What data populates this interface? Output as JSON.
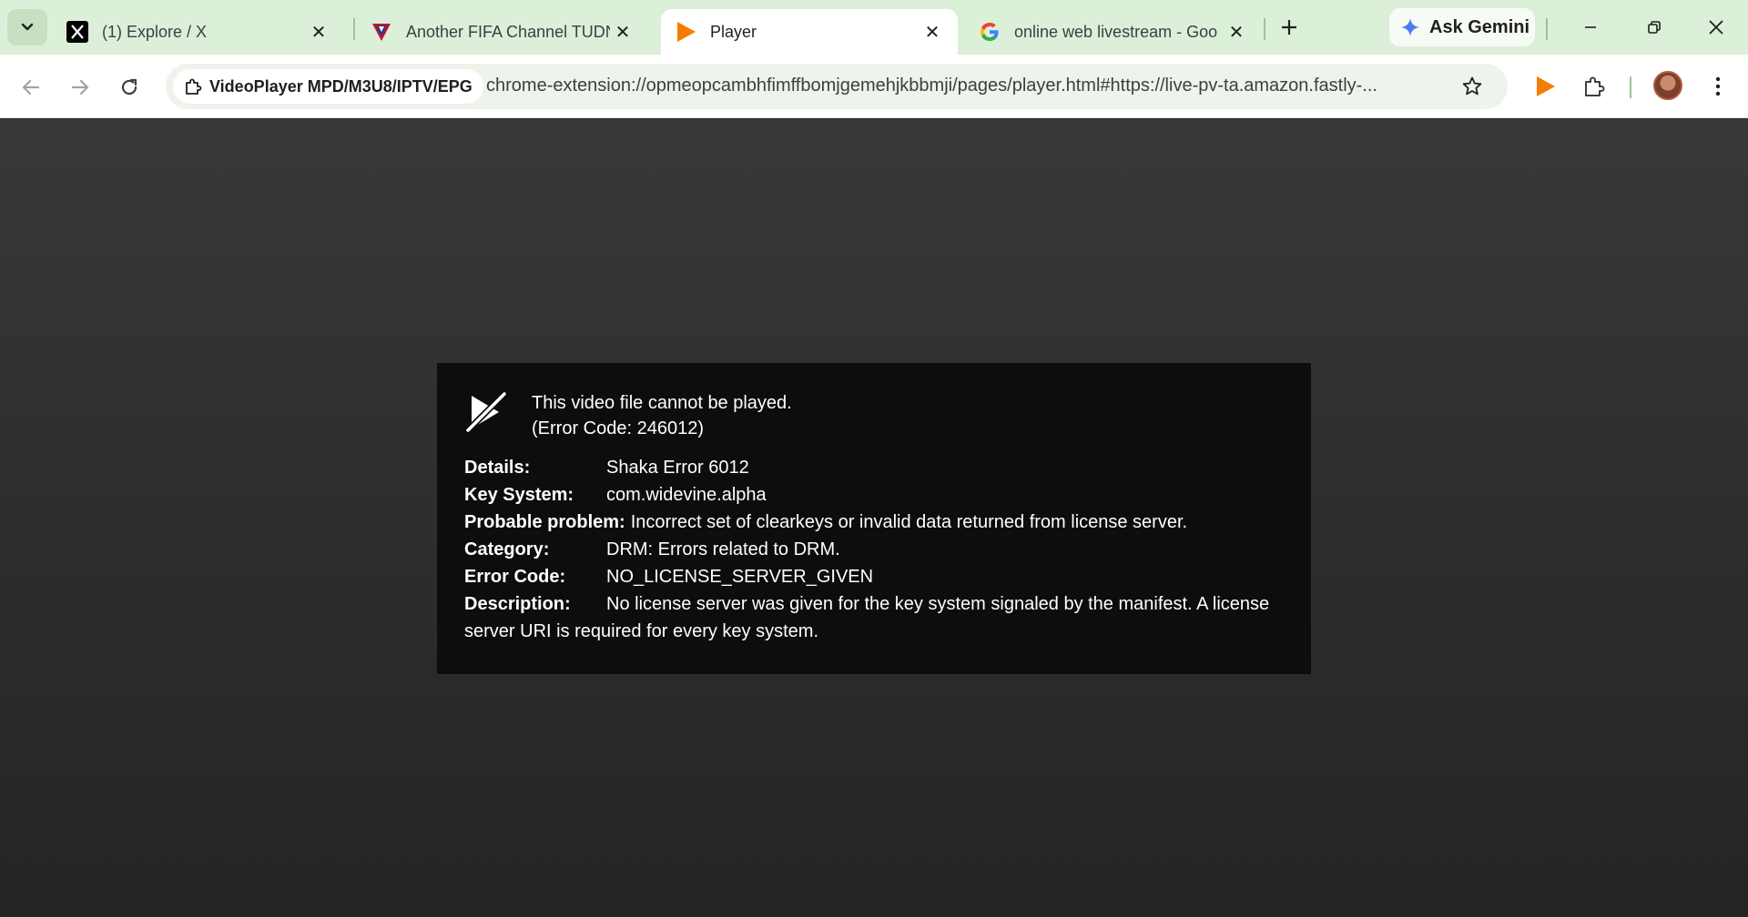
{
  "tabs": [
    {
      "title": "(1) Explore / X",
      "icon": "x-logo-icon"
    },
    {
      "title": "Another FIFA Channel TUDN",
      "icon": "tudn-logo-icon"
    },
    {
      "title": "Player",
      "icon": "play-logo-icon",
      "active": true
    },
    {
      "title": "online web livestream - Goo",
      "icon": "google-logo-icon"
    }
  ],
  "gemini": {
    "label": "Ask Gemini"
  },
  "omnibox": {
    "site_chip": "VideoPlayer MPD/M3U8/IPTV/EPG",
    "url": "chrome-extension://opmeopcambhfimffbomjgemehjkbbmji/pages/player.html#https://live-pv-ta.amazon.fastly-..."
  },
  "error": {
    "line1": "This video file cannot be played.",
    "line2": "(Error Code: 246012)",
    "details_label": "Details:",
    "details": "Shaka Error 6012",
    "key_system_label": "Key System:",
    "key_system": "com.widevine.alpha",
    "problem_label": "Probable problem:",
    "problem": "Incorrect set of clearkeys or invalid data returned from license server.",
    "category_label": "Category:",
    "category": "DRM: Errors related to DRM.",
    "code_label": "Error Code:",
    "code": "NO_LICENSE_SERVER_GIVEN",
    "description_label": "Description:",
    "description": "No license server was given for the key system signaled by the manifest. A license server URI is required for every key system."
  },
  "colors": {
    "tabstrip": "#dcefd8",
    "content_bg": "#2e2e2e",
    "error_bg": "#0d0d0d",
    "accent_orange": "#f57c00"
  }
}
